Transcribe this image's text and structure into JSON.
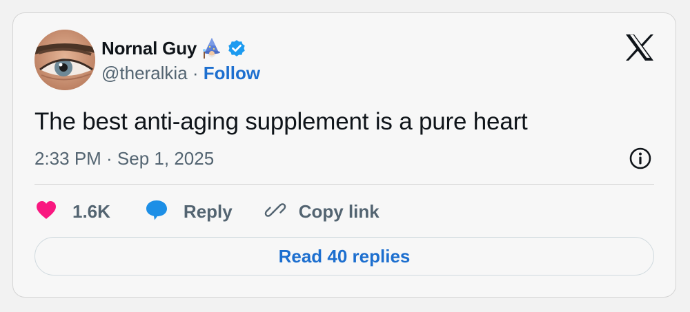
{
  "author": {
    "display_name": "Nornal Guy",
    "handle": "@theralkia",
    "separator": " · ",
    "follow_label": "Follow",
    "name_emoji": "wizard-emoji",
    "verified": true
  },
  "tweet": {
    "text": "The best anti-aging supplement is a pure heart",
    "timestamp": "2:33 PM · Sep 1, 2025"
  },
  "actions": {
    "like_count": "1.6K",
    "reply_label": "Reply",
    "copy_link_label": "Copy link"
  },
  "read_replies_label": "Read 40 replies",
  "icons": {
    "platform": "x-logo-icon",
    "info": "info-icon",
    "like": "heart-icon",
    "reply": "speech-bubble-icon",
    "copy": "link-icon",
    "verified": "verified-badge-icon"
  },
  "colors": {
    "link_blue": "#1d6fcf",
    "verified_blue": "#1d9bf0",
    "heart_pink": "#f91880",
    "text_primary": "#0f1419",
    "text_secondary": "#536471"
  }
}
